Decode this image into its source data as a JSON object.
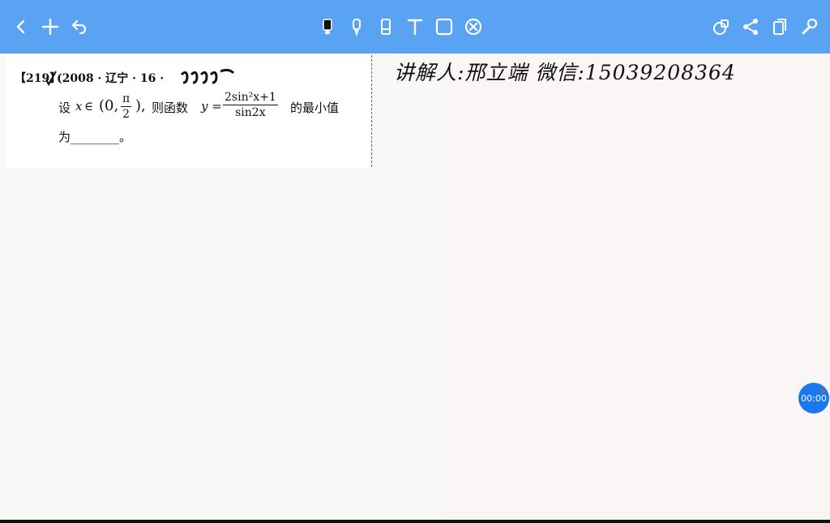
{
  "toolbar": {
    "left_icons": [
      "back-icon",
      "add-icon",
      "undo-icon"
    ],
    "center_tools": [
      "pen-icon",
      "marker-icon",
      "eraser-icon",
      "text-icon",
      "shape-icon",
      "clear-icon"
    ],
    "right_icons": [
      "layers-icon",
      "share-icon",
      "copy-icon",
      "settings-icon"
    ],
    "color": "#5aa3f2"
  },
  "question": {
    "number": "【219】",
    "source": "(2008 · 辽宁 · 16 ·",
    "line1_prefix": "设",
    "var_x": "x",
    "in_symbol": "∈",
    "interval_open": "(0,",
    "pi": "π",
    "two": "2",
    "interval_close": "),",
    "line1_mid": "则函数",
    "func_y": "y =",
    "numerator": "2sin²x+1",
    "denominator": "sin2x",
    "line1_suffix": "的最小值",
    "line2": "为________。"
  },
  "handwriting": {
    "text": "讲解人:邢立端   微信:15039208364"
  },
  "timer": {
    "label": "00:00",
    "color": "#1b79ee"
  }
}
